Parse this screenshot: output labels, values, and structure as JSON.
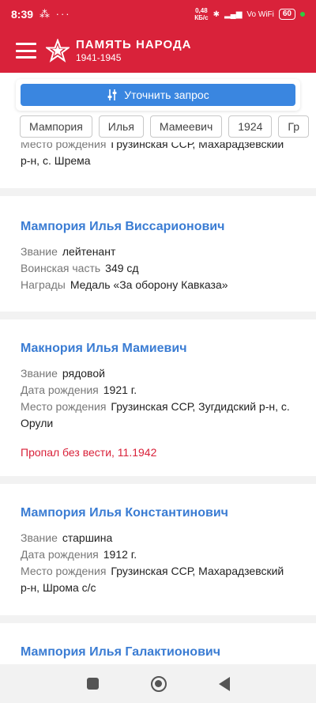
{
  "status_bar": {
    "time": "8:39",
    "left_icons": "⁂ ···",
    "speed_value": "0,48",
    "speed_unit": "КБ/с",
    "network": "Vo WiFi",
    "battery": "60"
  },
  "header": {
    "title": "ПАМЯТЬ НАРОДА",
    "years": "1941-1945"
  },
  "filter": {
    "refine_label": "Уточнить запрос",
    "chips": [
      "Мампория",
      "Илья",
      "Мамеевич",
      "1924",
      "Гр"
    ]
  },
  "results": [
    {
      "fields": [
        {
          "label": "Место рождения",
          "value": "Грузинская ССР, Махарадзевский р-н, с. Шрема"
        }
      ]
    },
    {
      "name": "Мампория Илья Виссарионович",
      "fields": [
        {
          "label": "Звание",
          "value": "лейтенант"
        },
        {
          "label": "Воинская часть",
          "value": "349 сд"
        },
        {
          "label": "Награды",
          "value": "Медаль «За оборону Кавказа»"
        }
      ]
    },
    {
      "name": "Макнория Илья Мамиевич",
      "fields": [
        {
          "label": "Звание",
          "value": "рядовой"
        },
        {
          "label": "Дата рождения",
          "value": "1921 г."
        },
        {
          "label": "Место рождения",
          "value": "Грузинская ССР, Зугдидский р-н, с. Орули"
        }
      ],
      "status": "Пропал без вести, 11.1942"
    },
    {
      "name": "Мампория Илья Константинович",
      "fields": [
        {
          "label": "Звание",
          "value": "старшина"
        },
        {
          "label": "Дата рождения",
          "value": "1912 г."
        },
        {
          "label": "Место рождения",
          "value": "Грузинская ССР, Махарадзевский р-н, Шрома с/с"
        }
      ]
    },
    {
      "name": "Мампория Илья Галактионович"
    }
  ],
  "colors": {
    "brand_red": "#d9223a",
    "link_blue": "#3a7cd3",
    "button_blue": "#3a86e0"
  }
}
